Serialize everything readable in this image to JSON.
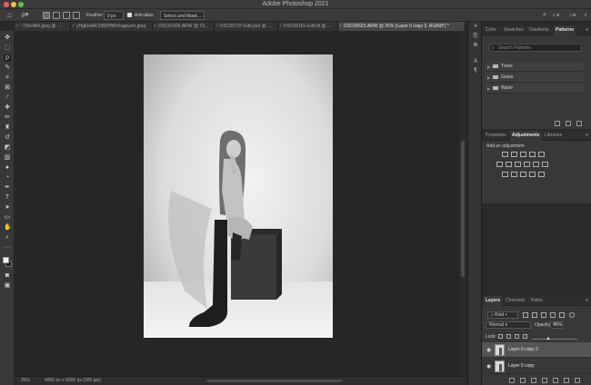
{
  "app": {
    "title": "Adobe Photoshop 2021"
  },
  "options_bar": {
    "feather_label": "Feather:",
    "feather_value": "0 px",
    "anti_alias_label": "Anti-alias",
    "anti_alias_checked": true,
    "select_mask_label": "Select and Mask..."
  },
  "tabs": [
    {
      "label": "~700x466.jpeg @ ..."
    },
    {
      "label": "yHgEkAACkB5PBBr0xqpyzm.jpeg"
    },
    {
      "label": "DSC01426.ARW @ 73..."
    },
    {
      "label": "DSC06727-Edit.psd @ ..."
    },
    {
      "label": "DSC06181-Edit.tif @ ..."
    },
    {
      "label": "DSC06623.ARW @ 25% (Layer 0 copy 2, RGB/8*) *",
      "active": true
    }
  ],
  "tab_overflow": "»",
  "status": {
    "zoom": "25%",
    "doc_info": "4000 px x 6000 px (300 ppi)"
  },
  "panels": {
    "top": {
      "tabs": [
        "Color",
        "Swatches",
        "Gradients",
        "Patterns"
      ],
      "active": "Patterns",
      "search_placeholder": "Search Patterns",
      "groups": [
        {
          "name": "Trees"
        },
        {
          "name": "Grass"
        },
        {
          "name": "Water"
        }
      ]
    },
    "middle": {
      "tabs": [
        "Properties",
        "Adjustments",
        "Libraries"
      ],
      "active": "Adjustments",
      "add_label": "Add an adjustment"
    },
    "layers": {
      "tabs": [
        "Layers",
        "Channels",
        "Paths"
      ],
      "active": "Layers",
      "kind_label": "Kind",
      "blend_mode": "Normal",
      "opacity_label": "Opacity:",
      "opacity_value": "45%",
      "lock_label": "Lock:",
      "layers": [
        {
          "name": "Layer 0 copy 2",
          "selected": true,
          "visible": true
        },
        {
          "name": "Layer 0 copy",
          "selected": false,
          "visible": true
        }
      ]
    }
  },
  "colors": {
    "foreground": "#f2f2f2",
    "background": "#1a1a1a",
    "canvas_bg": "#262626"
  }
}
